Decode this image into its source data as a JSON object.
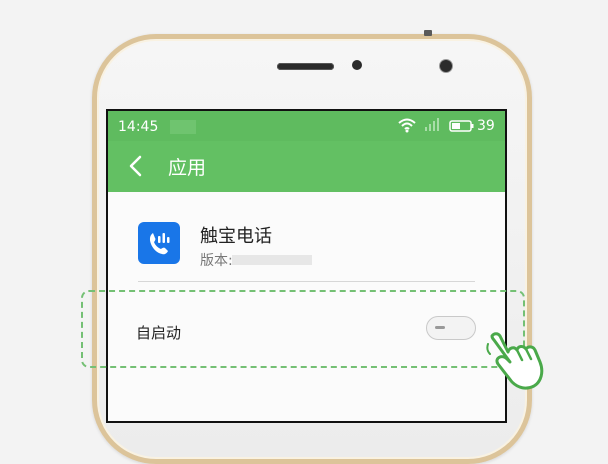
{
  "status_bar": {
    "time": "14:45",
    "battery_level": "39",
    "icons": [
      "wifi-icon",
      "signal-icon",
      "battery-icon"
    ]
  },
  "app_bar": {
    "title": "应用",
    "back_icon": "chevron-left-icon"
  },
  "app_info": {
    "name": "触宝电话",
    "version_label": "版本:",
    "icon": "phone-app-icon"
  },
  "settings": {
    "auto_start_label": "自启动",
    "auto_start_enabled": false
  },
  "colors": {
    "status_bar": "#5fbb5f",
    "app_bar": "#63c063",
    "highlight": "#74c074",
    "app_icon_bg": "#1976e8"
  }
}
